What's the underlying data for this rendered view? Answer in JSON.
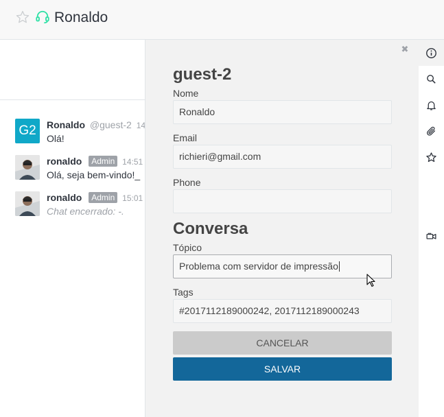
{
  "header": {
    "room_name": "Ronaldo",
    "icons": [
      "star-icon",
      "headset-icon"
    ]
  },
  "messages": [
    {
      "avatar_text": "G2",
      "name": "Ronaldo",
      "handle": "@guest-2",
      "time": "14",
      "text": "Olá!"
    },
    {
      "avatar_text": "",
      "name": "ronaldo",
      "badge": "Admin",
      "time": "14:51",
      "text": "Olá, seja bem-vindo!_"
    },
    {
      "avatar_text": "",
      "name": "ronaldo",
      "badge": "Admin",
      "time": "15:01",
      "text": "Chat encerrado: -."
    }
  ],
  "panel": {
    "guest_title": "guest-2",
    "name_label": "Nome",
    "name_value": "Ronaldo",
    "email_label": "Email",
    "email_value": "richieri@gmail.com",
    "phone_label": "Phone",
    "phone_value": "",
    "conversation_title": "Conversa",
    "topic_label": "Tópico",
    "topic_value": "Problema com servidor de impressão",
    "tags_label": "Tags",
    "tags_value": "#2017112189000242, 2017112189000243",
    "cancel_label": "CANCELAR",
    "save_label": "SALVAR",
    "close_icon": "close-icon"
  },
  "toolbar": {
    "icons": [
      "info-icon",
      "search-icon",
      "bell-icon",
      "paperclip-icon",
      "star-icon",
      "video-icon"
    ]
  },
  "colors": {
    "primary": "#13679a",
    "guest_avatar": "#10a8c8",
    "agent_icon": "#2de0a5"
  }
}
